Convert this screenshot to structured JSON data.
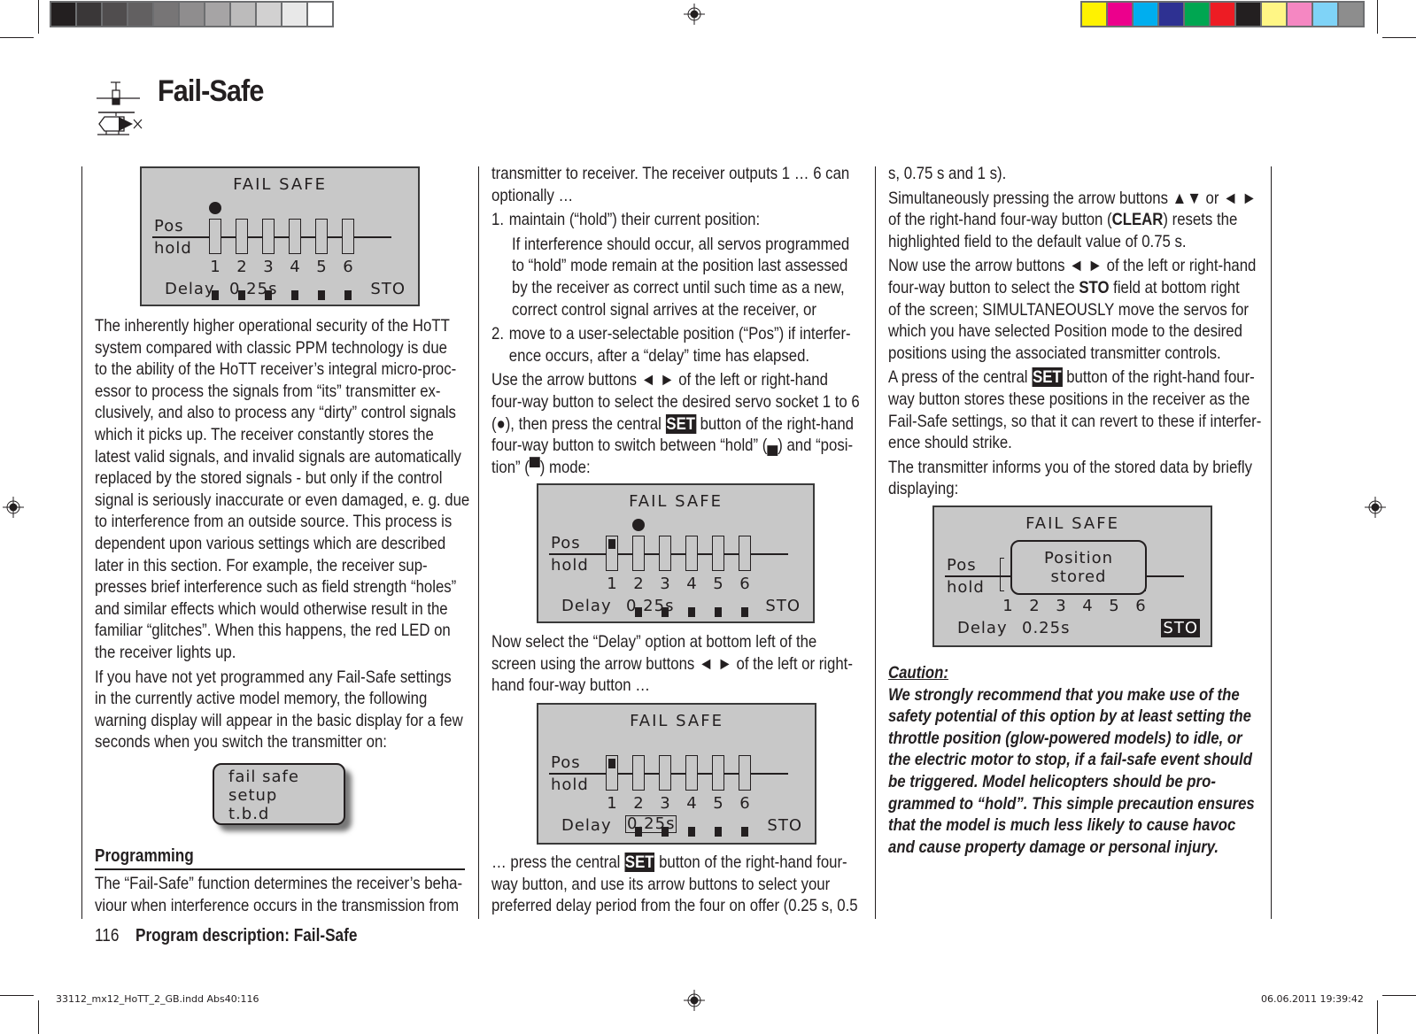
{
  "color_bars": {
    "grayscale": [
      "#231f20",
      "#3a3738",
      "#504d4e",
      "#626061",
      "#777576",
      "#8f8d8e",
      "#a6a4a5",
      "#bcbbbb",
      "#d2d1d1",
      "#e8e8e8",
      "#ffffff"
    ],
    "process": [
      "#fff200",
      "#ec008c",
      "#00aeef",
      "#2e3192",
      "#00a651",
      "#ed1c24",
      "#231f20",
      "#fff685",
      "#f587c2",
      "#7fd3f7",
      "#8d8d8d"
    ]
  },
  "header": {
    "title": "Fail-Safe",
    "icon": "helicopter-model-icon"
  },
  "screens": {
    "screen1": {
      "title": "FAIL SAFE",
      "pos_label": "Pos",
      "hold_label": "hold",
      "channels": [
        "1",
        "2",
        "3",
        "4",
        "5",
        "6"
      ],
      "modes": [
        "hold",
        "hold",
        "hold",
        "hold",
        "hold",
        "hold"
      ],
      "selected_channel": 1,
      "delay_label": "Delay",
      "delay_value": "0.25s",
      "sto_label": "STO"
    },
    "screen2": {
      "title": "FAIL SAFE",
      "pos_label": "Pos",
      "hold_label": "hold",
      "channels": [
        "1",
        "2",
        "3",
        "4",
        "5",
        "6"
      ],
      "modes": [
        "pos",
        "hold",
        "hold",
        "hold",
        "hold",
        "hold"
      ],
      "selected_channel": 2,
      "delay_label": "Delay",
      "delay_value": "0.25s",
      "sto_label": "STO"
    },
    "screen3": {
      "title": "FAIL SAFE",
      "pos_label": "Pos",
      "hold_label": "hold",
      "channels": [
        "1",
        "2",
        "3",
        "4",
        "5",
        "6"
      ],
      "modes": [
        "pos",
        "hold",
        "hold",
        "hold",
        "hold",
        "hold"
      ],
      "selected_field": "delay",
      "delay_label": "Delay",
      "delay_value": "0.25s",
      "sto_label": "STO"
    },
    "screen4": {
      "title": "FAIL SAFE",
      "pos_label": "Pos",
      "hold_label": "hold",
      "channels": [
        "1",
        "2",
        "3",
        "4",
        "5",
        "6"
      ],
      "popup_line1": "Position",
      "popup_line2": "stored",
      "selected_field": "STO",
      "delay_label": "Delay",
      "delay_value": "0.25s",
      "sto_label": "STO"
    },
    "warning": {
      "line1": "fail safe",
      "line2": "setup",
      "line3": "t.b.d"
    }
  },
  "col1": {
    "p1": [
      "The inherently higher operational security of the HoTT",
      "system compared with classic PPM technology is due",
      "to the ability of the HoTT receiver’s integral micro-proc-",
      "essor to process the signals from “its” transmitter ex-",
      "clusively, and also to process any “dirty” control signals",
      "which it picks up. The receiver constantly stores the",
      "latest valid signals, and invalid signals are automatically",
      "replaced by the stored signals - but only if the control",
      "signal is seriously inaccurate or even damaged, e. g. due",
      "to interference from an outside source. This process is",
      "dependent upon various settings which are described",
      "later in this section. For example, the receiver sup-",
      "presses brief interference such as field strength “holes”",
      "and similar effects which would otherwise result in the",
      "familiar “glitches”. When this happens, the red LED on",
      "the receiver lights up."
    ],
    "p2": [
      "If you have not yet programmed any Fail-Safe settings",
      "in the currently active model memory, the following",
      "warning display will appear in the basic display for a few",
      "seconds when you switch the transmitter on:"
    ],
    "heading": "Programming",
    "p3": [
      "The “Fail-Safe” function determines the receiver’s beha-",
      "viour when interference occurs in the transmission from"
    ]
  },
  "col2": {
    "p1": [
      "transmitter to receiver. The receiver outputs 1 … 6 can",
      "optionally …"
    ],
    "item1_num": "1.",
    "item1": "maintain (“hold”) their current position:",
    "item1_detail": [
      "If interference should occur, all servos programmed",
      "to “hold” mode remain at the position last assessed",
      "by the receiver as correct until such time as a new,",
      "correct control signal arrives at the receiver, or"
    ],
    "item2_num": "2.",
    "item2": [
      "move to a user-selectable position (“Pos”) if interfer-",
      "ence occurs, after a “delay” time has elapsed."
    ],
    "p2_l1": "Use the arrow buttons ◄ ► of the left or right-hand",
    "p2_l2": "four-way button to select the desired servo socket 1 to 6",
    "p2_l3a": "(●), then press the central",
    "set": "SET",
    "p2_l3b": "button of the right-hand",
    "p2_l4": "four-way button to switch between “hold” (▄) and “posi-",
    "p2_l5": "tion” (▀) mode:",
    "p3": [
      "Now select the “Delay” option at bottom left of the",
      "screen using the arrow buttons ◄ ► of the left or right-",
      "hand four-way button …"
    ],
    "p4_l1a": "… press the central",
    "p4_l1b": "button of the right-hand four-",
    "p4_rest": [
      "way button, and use its arrow buttons to select your",
      "preferred delay period from the four on offer (0.25 s, 0.5"
    ]
  },
  "col3": {
    "p0": "s, 0.75 s and 1 s).",
    "p1_l1": "Simultaneously pressing the arrow buttons ▲▼ or ◄ ►",
    "p1_l2a": "of the right-hand four-way button (",
    "p1_clear": "CLEAR",
    "p1_l2b": ") resets the",
    "p1_l3": "highlighted field to the default value of 0.75 s.",
    "p2_l1": "Now use the arrow buttons ◄ ► of the left or right-hand",
    "p2_l2a": "four-way button to select the ",
    "p2_sto": "STO",
    "p2_l2b": " field at bottom right",
    "p2_rest": [
      "of the screen; SIMULTANEOUSLY move the servos for",
      "which you have selected Position mode to the desired",
      "positions using the associated transmitter controls."
    ],
    "p3_l1a": "A press of the central",
    "p3_l1b": "button of the right-hand four-",
    "p3_rest": [
      "way button stores these positions in the receiver as the",
      "Fail-Safe settings, so that it can revert to these if interfer-",
      "ence should strike."
    ],
    "p4": [
      "The transmitter informs you of the stored data by briefly",
      "displaying:"
    ],
    "caution_label": "Caution:",
    "caution": [
      "We strongly recommend that you make use of the",
      "safety potential of this option by at least setting the",
      "throttle position (glow-powered models) to idle, or",
      "the electric motor to stop, if a fail-safe event should",
      "be triggered. Model helicopters should be pro-",
      "grammed to “hold”. This simple precaution ensures",
      "that the model is much less likely to cause havoc",
      "and cause property damage or personal injury."
    ]
  },
  "footer": {
    "page_number": "116",
    "section": "Program description: Fail-Safe"
  },
  "slug": {
    "file": "33112_mx12_HoTT_2_GB.indd   Abs40:116",
    "datetime": "06.06.2011   19:39:42"
  }
}
